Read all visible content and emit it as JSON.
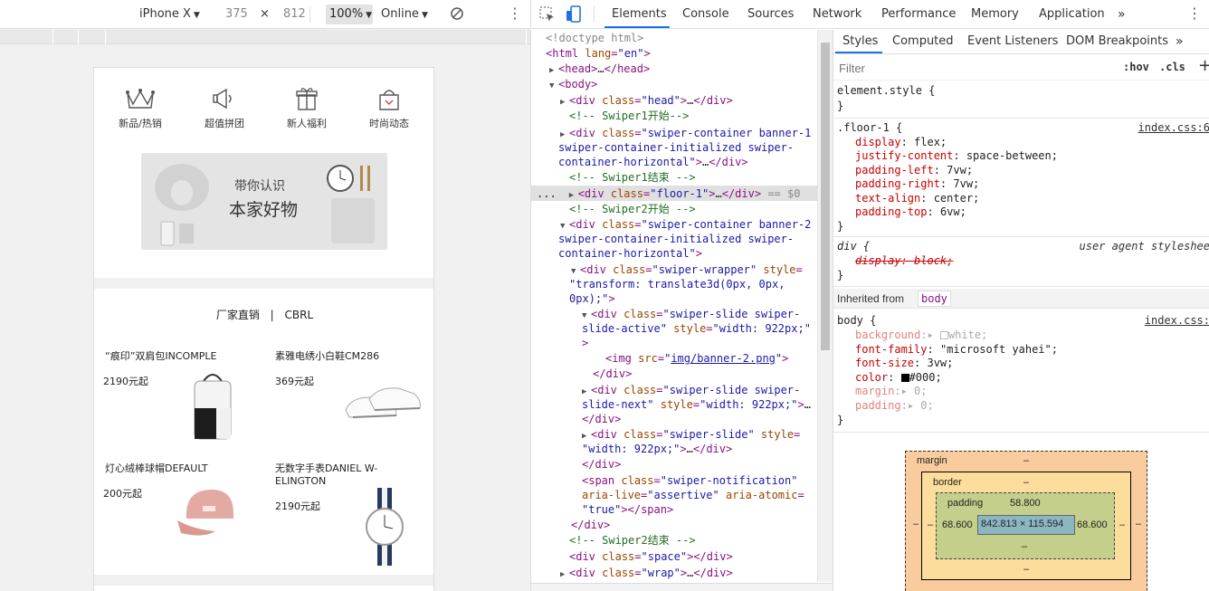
{
  "device_toolbar": {
    "device": "iPhone X",
    "width": "375",
    "times": "×",
    "height": "812",
    "zoom": "100%",
    "network": "Online"
  },
  "mobile_page": {
    "nav": [
      {
        "label": "新品/热销",
        "icon": "crown-icon"
      },
      {
        "label": "超值拼团",
        "icon": "megaphone-icon"
      },
      {
        "label": "新人福利",
        "icon": "gift-icon"
      },
      {
        "label": "时尚动态",
        "icon": "bag-icon"
      }
    ],
    "banner": {
      "line1": "带你认识",
      "line2": "本家好物"
    },
    "brand_left": "厂家直销",
    "brand_sep": "|",
    "brand_right": "CBRL",
    "products": [
      {
        "name": "“痕印”双肩包INCOMPLE",
        "price": "2190元起",
        "image": "backpack"
      },
      {
        "name": "素雅电绣小白鞋CM286",
        "price": "369元起",
        "image": "sneakers"
      },
      {
        "name": "灯心绒棒球帽DEFAULT",
        "price": "200元起",
        "image": "cap"
      },
      {
        "name": "无数字手表DANIEL W-ELINGTON",
        "price": "2190元起",
        "image": "watch"
      }
    ]
  },
  "devtools": {
    "tabs": [
      "Elements",
      "Console",
      "Sources",
      "Network",
      "Performance",
      "Memory",
      "Application"
    ],
    "active_tab": "Elements",
    "more": "»",
    "elements": {
      "doctype": "<!doctype html>",
      "html_open_tag": "html",
      "lang_attr": "lang",
      "lang_val": "en",
      "head": "head",
      "body": "body",
      "div": "div",
      "span": "span",
      "img": "img",
      "class": "class",
      "style": "style",
      "src": "src",
      "head_class": "head",
      "c_swiper1_start": "<!-- Swiper1开始-->",
      "banner1_class_1": "swiper-container banner-1",
      "banner1_class_2": "swiper-container-initialized swiper-",
      "banner1_class_3": "container-horizontal",
      "c_swiper1_end": "<!-- Swiper1结束 -->",
      "floor_class": "floor-1",
      "selected_suffix": "== $0",
      "c_swiper2_start": "<!-- Swiper2开始 -->",
      "banner2_class_1": "swiper-container banner-2",
      "banner2_class_2": "swiper-container-initialized swiper-",
      "banner2_class_3": "container-horizontal",
      "wrapper_class": "swiper-wrapper",
      "wrapper_style_1": "\"",
      "wrapper_style_2": "transform: translate3d(0px, 0px,",
      "wrapper_style_3": "0px);",
      "slide_active_class_1": "swiper-slide swiper-",
      "slide_active_class_2": "slide-active",
      "slide_width": "width: 922px;",
      "img_src": "img/banner-2.png",
      "slide_next_class_1": "swiper-slide swiper-",
      "slide_next_class_2": "slide-next",
      "slide_class": "swiper-slide",
      "notif_class": "swiper-notification",
      "aria_live": "aria-live",
      "aria_live_val": "assertive",
      "aria_atomic": "aria-atomic",
      "aria_atomic_val": "true",
      "c_swiper2_end": "<!-- Swiper2结束 -->",
      "space_class": "space",
      "wrap_class": "wrap",
      "ellipsis": "…",
      "dots": "..."
    },
    "styles": {
      "subtabs": [
        "Styles",
        "Computed",
        "Event Listeners",
        "DOM Breakpoints"
      ],
      "filter_placeholder": "Filter",
      "hov": ":hov",
      "cls": ".cls",
      "plus": "+",
      "element_style": "element.style {",
      "close_brace": "}",
      "floor_selector": ".floor-1 {",
      "floor_source": "index.css:6",
      "floor_props": [
        {
          "p": "display",
          "v": "flex;"
        },
        {
          "p": "justify-content",
          "v": "space-between;"
        },
        {
          "p": "padding-left",
          "v": "7vw;"
        },
        {
          "p": "padding-right",
          "v": "7vw;"
        },
        {
          "p": "text-align",
          "v": "center;"
        },
        {
          "p": "padding-top",
          "v": "6vw;"
        }
      ],
      "div_selector": "div {",
      "ua_source": "user agent styleshee",
      "div_prop": "display: block;",
      "inherited_label": "Inherited from",
      "inherited_from": "body",
      "body_selector": "body {",
      "body_source": "index.css:",
      "body_props": [
        {
          "p": "background",
          "v": "white;",
          "muted": true,
          "swatch": "#ffffff"
        },
        {
          "p": "font-family",
          "v": "\"microsoft yahei\";"
        },
        {
          "p": "font-size",
          "v": "3vw;"
        },
        {
          "p": "color",
          "v": "#000;",
          "swatch": "#000000"
        },
        {
          "p": "margin",
          "v": "0;",
          "muted": true
        },
        {
          "p": "padding",
          "v": "0;",
          "muted": true
        }
      ]
    },
    "box_model": {
      "margin_label": "margin",
      "margin_val": "–",
      "border_label": "border",
      "border_val": "–",
      "padding_label": "padding",
      "padding_top": "58.800",
      "padding_left": "68.600",
      "padding_right": "68.600",
      "padding_bottom": "–",
      "content": "842.813 × 115.594",
      "dash": "–"
    }
  },
  "colors": {
    "accent": "#1a73e8",
    "tag": "#881280",
    "attr": "#994500",
    "value": "#1a1aa6",
    "comment": "#236e25"
  }
}
